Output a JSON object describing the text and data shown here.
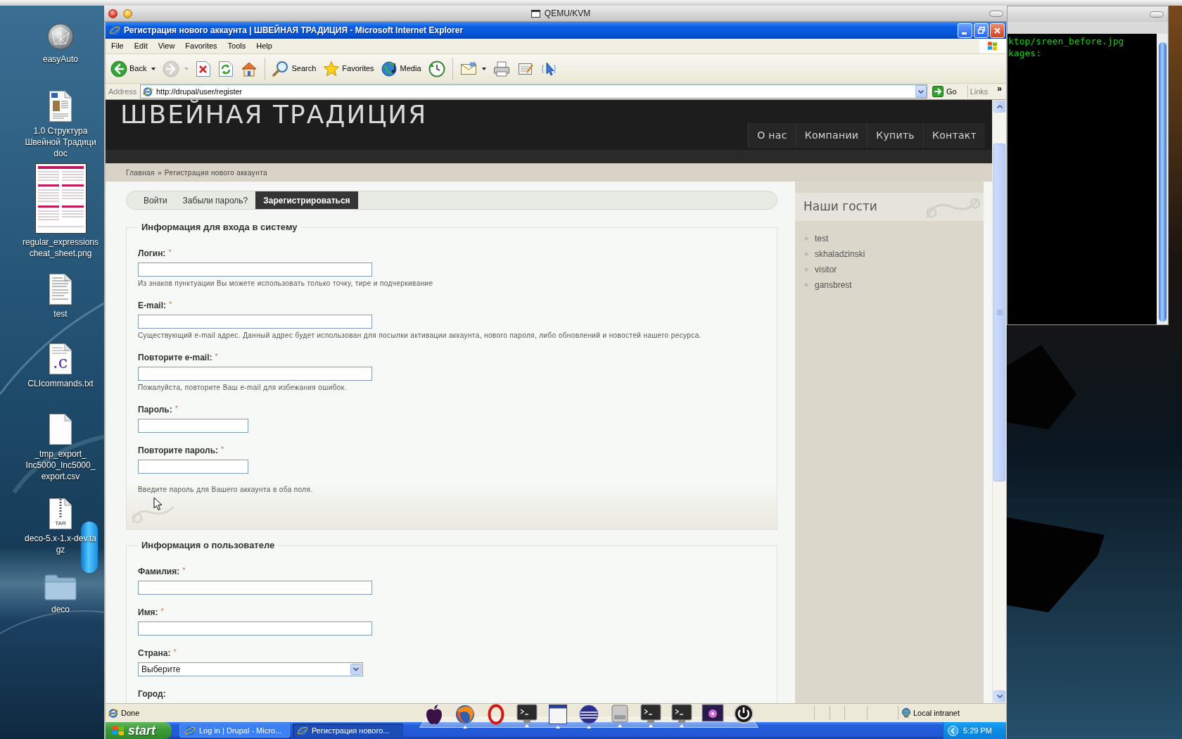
{
  "qemu": {
    "title": "QEMU/KVM"
  },
  "desktop_icons": [
    {
      "kind": "disk",
      "label": [
        "easyAuto"
      ]
    },
    {
      "kind": "document",
      "label": [
        "1.0 Структура",
        "Швейной Традици",
        "doc"
      ]
    },
    {
      "kind": "image",
      "label": [
        "regular_expressions",
        "cheat_sheet.png"
      ]
    },
    {
      "kind": "text",
      "label": [
        "test"
      ]
    },
    {
      "kind": "code",
      "badge": ".c",
      "label": [
        "CLIcommands.txt"
      ]
    },
    {
      "kind": "file",
      "label": [
        "_tmp_export_",
        "Inc5000_Inc5000_",
        "export.csv"
      ]
    },
    {
      "kind": "archive",
      "badge": "TAR",
      "label": [
        "deco-5.x-1.x-dev.ta",
        "gz"
      ]
    },
    {
      "kind": "folder",
      "label": [
        "deco"
      ]
    }
  ],
  "terminal": {
    "lines": [
      "ktop/sreen_before.jpg",
      "kages:"
    ]
  },
  "browser": {
    "title": "Регистрация нового аккаунта | ШВЕЙНАЯ ТРАДИЦИЯ - Microsoft Internet Explorer",
    "menu": [
      "File",
      "Edit",
      "View",
      "Favorites",
      "Tools",
      "Help"
    ],
    "toolbar": [
      [
        {
          "kind": "back",
          "label": "Back",
          "dropdown": true,
          "disabled": false
        },
        {
          "kind": "forward",
          "dropdown": true,
          "disabled": true
        },
        {
          "kind": "stop",
          "dropdown": false,
          "disabled": false
        },
        {
          "kind": "refresh",
          "dropdown": false,
          "disabled": false
        },
        {
          "kind": "home",
          "dropdown": false,
          "disabled": false
        }
      ],
      [
        {
          "kind": "search",
          "label": "Search",
          "dropdown": false,
          "disabled": false
        },
        {
          "kind": "favorites",
          "label": "Favorites",
          "dropdown": false,
          "disabled": false
        },
        {
          "kind": "media",
          "label": "Media",
          "dropdown": false,
          "disabled": false
        },
        {
          "kind": "history",
          "dropdown": false,
          "disabled": false
        }
      ],
      [
        {
          "kind": "mail",
          "dropdown": true,
          "disabled": false
        },
        {
          "kind": "print",
          "dropdown": false,
          "disabled": false
        },
        {
          "kind": "edit",
          "dropdown": false,
          "disabled": false
        },
        {
          "kind": "messenger",
          "dropdown": false,
          "disabled": false
        }
      ]
    ],
    "address": {
      "label": "Address",
      "url": "http://drupal/user/register",
      "go": "Go",
      "links": "Links",
      "more": "»"
    },
    "status": {
      "text": "Done",
      "zone": "Local intranet"
    }
  },
  "page": {
    "logo": "ШВЕЙНАЯ ТРАДИЦИЯ",
    "nav": [
      "О нас",
      "Компании",
      "Купить",
      "Контакт"
    ],
    "breadcrumb": {
      "links": [
        "Главная"
      ],
      "separator": "»",
      "current": "Регистрация нового аккаунта"
    },
    "tabs": [
      {
        "label": "Войти",
        "selected": false
      },
      {
        "label": "Забыли пароль?",
        "selected": false
      },
      {
        "label": "Зарегистрироваться",
        "selected": true
      }
    ],
    "required_mark": "*",
    "fieldsets": [
      {
        "legend": "Информация для входа в систему",
        "fields": [
          {
            "kind": "text",
            "label": "Логин:",
            "required": true,
            "description": "Из знаков пунктуации Вы можете использовать только точку, тире и подчеркивание"
          },
          {
            "kind": "text",
            "label": "E-mail:",
            "required": true,
            "description": "Существующий e-mail адрес. Данный адрес будет использован для посылки активации аккаунта, нового пароля, либо обновлений и новостей нашего ресурса."
          },
          {
            "kind": "text",
            "label": "Повторите e-mail:",
            "required": true,
            "description": "Пожалуйста, повторите Ваш e-mail для избежания ошибок."
          },
          {
            "kind": "password",
            "label": "Пароль:",
            "required": true
          },
          {
            "kind": "password",
            "label": "Повторите пароль:",
            "required": true
          }
        ],
        "note": "Введите пароль для Вашего аккаунта в оба поля."
      },
      {
        "legend": "Информация о пользователе",
        "fields": [
          {
            "kind": "text",
            "label": "Фамилия:",
            "required": true
          },
          {
            "kind": "text",
            "label": "Имя:",
            "required": true
          },
          {
            "kind": "select",
            "label": "Страна:",
            "required": true,
            "value": "Выберите"
          },
          {
            "kind": "label",
            "label": "Город:",
            "required": false
          }
        ]
      }
    ],
    "sidebar": {
      "title": "Наши гости",
      "items": [
        "test",
        "skhaladzinski",
        "visitor",
        "gansbrest"
      ]
    }
  },
  "dock": [
    {
      "kind": "apple",
      "running": false
    },
    {
      "kind": "globe",
      "running": true
    },
    {
      "kind": "ring",
      "running": false
    },
    {
      "kind": "terminal",
      "running": true
    },
    {
      "kind": "window",
      "running": true
    },
    {
      "kind": "sphere",
      "running": true
    },
    {
      "kind": "drive",
      "running": true
    },
    {
      "kind": "terminal",
      "running": true
    },
    {
      "kind": "terminal",
      "running": true
    },
    {
      "kind": "picture",
      "running": false
    },
    {
      "kind": "power",
      "running": false
    }
  ],
  "taskbar": {
    "start": "start",
    "tasks": [
      {
        "label": "Log in | Drupal - Micro...",
        "selected": false
      },
      {
        "label": "Регистрация нового...",
        "selected": true
      }
    ],
    "clock": "5:29 PM"
  }
}
